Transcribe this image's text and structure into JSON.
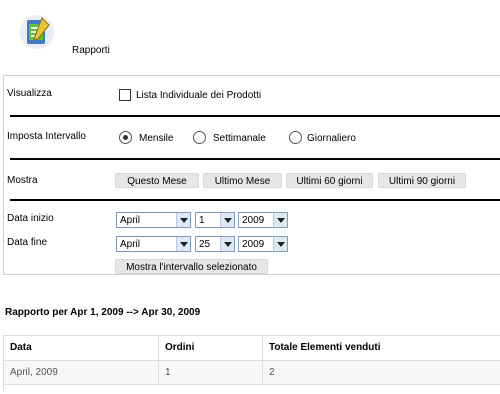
{
  "header": {
    "title": "Rapporti",
    "icon": "report-document-icon"
  },
  "filters": {
    "view_label": "Visualizza",
    "view_checkbox_label": "Lista Individuale dei Prodotti",
    "view_checkbox_checked": false,
    "interval_label": "Imposta Intervallo",
    "interval_options": [
      {
        "label": "Mensile",
        "checked": true
      },
      {
        "label": "Settimanale",
        "checked": false
      },
      {
        "label": "Giornaliero",
        "checked": false
      }
    ],
    "show_label": "Mostra",
    "show_buttons": [
      "Questo Mese",
      "Ultimo Mese",
      "Ultimi 60 giorni",
      "Ultimi 90 giorni"
    ],
    "start_label": "Data inizio",
    "start": {
      "month": "April",
      "day": "1",
      "year": "2009"
    },
    "end_label": "Data fine",
    "end": {
      "month": "April",
      "day": "25",
      "year": "2009"
    },
    "apply_button": "Mostra l'intervallo selezionato"
  },
  "report": {
    "title": "Rapporto per Apr 1, 2009 --> Apr 30, 2009",
    "columns": [
      "Data",
      "Ordini",
      "Totale Elementi venduti"
    ],
    "rows": [
      [
        "April, 2009",
        "1",
        "2"
      ]
    ]
  }
}
